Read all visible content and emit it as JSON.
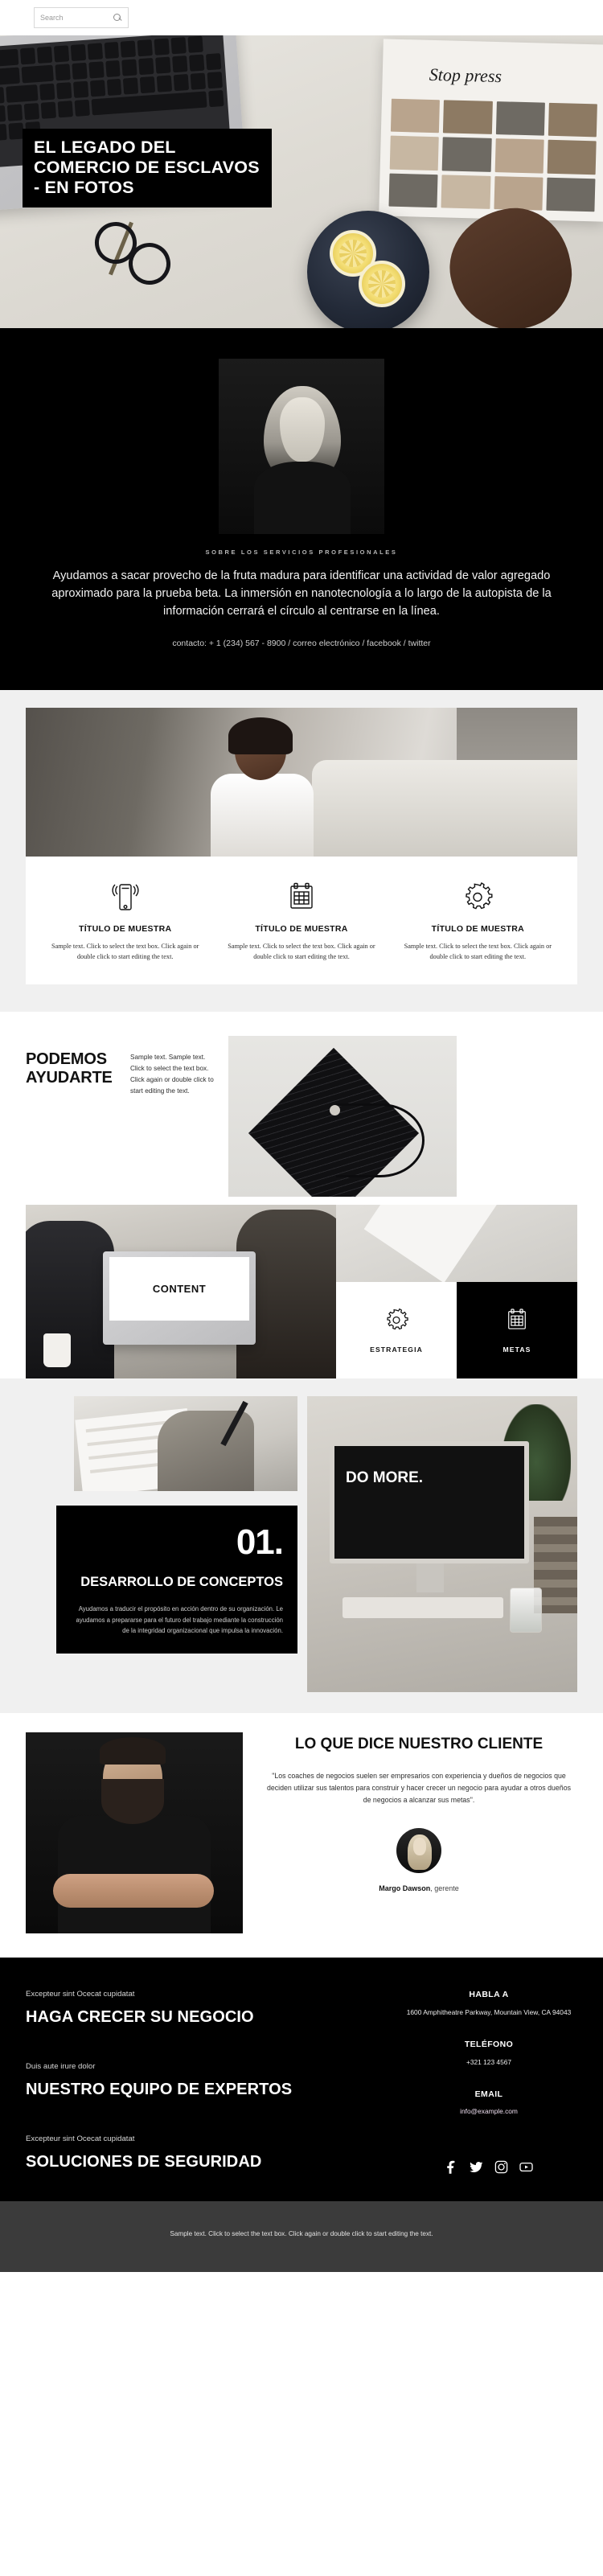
{
  "search": {
    "placeholder": "Search",
    "icon": "search-icon"
  },
  "hero": {
    "title": "EL LEGADO DEL COMERCIO DE ESCLAVOS - EN FOTOS",
    "magazine_text": "Stop press"
  },
  "about": {
    "eyebrow": "SOBRE LOS SERVICIOS PROFESIONALES",
    "paragraph": "Ayudamos a sacar provecho de la fruta madura para identificar una actividad de valor agregado aproximado para la prueba beta. La inmersión en nanotecnología a lo largo de la autopista de la información cerrará el círculo al centrarse en la línea.",
    "contact": "contacto: + 1 (234) 567 - 8900 / correo electrónico / facebook / twitter"
  },
  "services": {
    "items": [
      {
        "icon": "mobile-signal-icon",
        "title": "TÍTULO DE MUESTRA",
        "text": "Sample text. Click to select the text box. Click again or double click to start editing the text."
      },
      {
        "icon": "calendar-icon",
        "title": "TÍTULO DE MUESTRA",
        "text": "Sample text. Click to select the text box. Click again or double click to start editing the text."
      },
      {
        "icon": "gear-icon",
        "title": "TÍTULO DE MUESTRA",
        "text": "Sample text. Click to select the text box. Click again or double click to start editing the text."
      }
    ]
  },
  "help": {
    "title": "PODEMOS AYUDARTE",
    "text": "Sample text. Sample text. Click to select the text box. Click again or double click to start editing the text.",
    "cards": [
      {
        "icon": "gear-icon",
        "label": "ESTRATEGIA"
      },
      {
        "icon": "calendar-icon",
        "label": "METAS"
      }
    ]
  },
  "concept": {
    "number": "01.",
    "heading": "DESARROLLO DE CONCEPTOS",
    "text": "Ayudamos a traducir el propósito en acción dentro de su organización. Le ayudamos a prepararse para el futuro del trabajo mediante la construcción de la integridad organizacional que impulsa la innovación.",
    "screen_text": "DO MORE."
  },
  "testimonial": {
    "heading": "LO QUE DICE NUESTRO CLIENTE",
    "quote": "\"Los coaches de negocios suelen ser empresarios con experiencia y dueños de negocios que deciden utilizar sus talentos para construir y hacer crecer un negocio para ayudar a otros dueños de negocios a alcanzar sus metas\".",
    "author_name": "Margo Dawson",
    "author_role": ", gerente"
  },
  "footer": {
    "blocks": [
      {
        "small": "Excepteur sint Ocecat cupidatat",
        "big": "HAGA CRECER SU NEGOCIO"
      },
      {
        "small": "Duis aute irure dolor",
        "big": "NUESTRO EQUIPO DE EXPERTOS"
      },
      {
        "small": "Excepteur sint Ocecat cupidatat",
        "big": "SOLUCIONES DE SEGURIDAD"
      }
    ],
    "contact": {
      "address_heading": "HABLA A",
      "address": "1600 Amphitheatre Parkway, Mountain View, CA 94043",
      "phone_heading": "TELÉFONO",
      "phone": "+321 123 4567",
      "email_heading": "EMAIL",
      "email": "info@example.com",
      "email_color": "#efdff1"
    },
    "socials": [
      {
        "icon": "facebook-icon"
      },
      {
        "icon": "twitter-icon"
      },
      {
        "icon": "instagram-icon"
      },
      {
        "icon": "youtube-icon"
      }
    ]
  },
  "bottom": {
    "text": "Sample text. Click to select the text box. Click again or double click to start editing the text."
  }
}
